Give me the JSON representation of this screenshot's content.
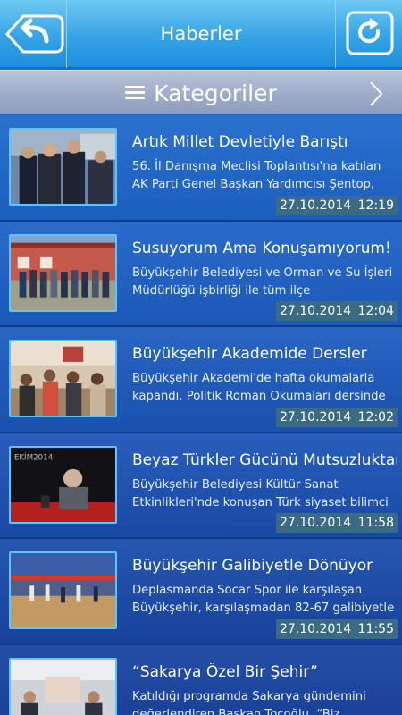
{
  "header": {
    "title": "Haberler"
  },
  "category_bar": {
    "label": "Kategoriler"
  },
  "news": [
    {
      "title": "Artık Millet Devletiyle Barıştı",
      "summary": "56. İl Danışma Meclisi Toplantısı'na katılan AK Parti Genel Başkan Yardımcısı Şentop,",
      "date": "27.10.2014",
      "time": "12:19"
    },
    {
      "title": "Susuyorum Ama Konuşamıyorum!",
      "summary": "Büyükşehir Belediyesi ve Orman ve Su İşleri Müdürlüğü işbirliği ile tüm ilçe belediyelerine",
      "date": "27.10.2014",
      "time": "12:04"
    },
    {
      "title": "Büyükşehir Akademide Dersler",
      "summary": "Büyükşehir Akademi'de hafta okumalarla kapandı. Politik Roman Okumaları dersinde",
      "date": "27.10.2014",
      "time": "12:02"
    },
    {
      "title": "Beyaz Türkler Gücünü Mutsuzluktan",
      "summary": "Büyükşehir Belediyesi Kültür Sanat Etkinlikleri'nde konuşan Türk siyaset bilimci",
      "date": "27.10.2014",
      "time": "11:58",
      "image_text": "EKİM2014"
    },
    {
      "title": "Büyükşehir Galibiyetle Dönüyor",
      "summary": "Deplasmanda Socar Spor ile karşılaşan Büyükşehir, karşılaşmadan 82-67 galibiyetle",
      "date": "27.10.2014",
      "time": "11:55"
    },
    {
      "title": "“Sakarya Özel Bir Şehir”",
      "summary": "Katıldığı programda Sakarya gündemini değerlendiren Başkan Toçoğlu, “Biz, şehrimizin",
      "date": "",
      "time": ""
    }
  ],
  "icons": {
    "back": "back-arrow-icon",
    "refresh": "refresh-icon",
    "menu": "hamburger-menu-icon",
    "next": "chevron-right-icon"
  }
}
